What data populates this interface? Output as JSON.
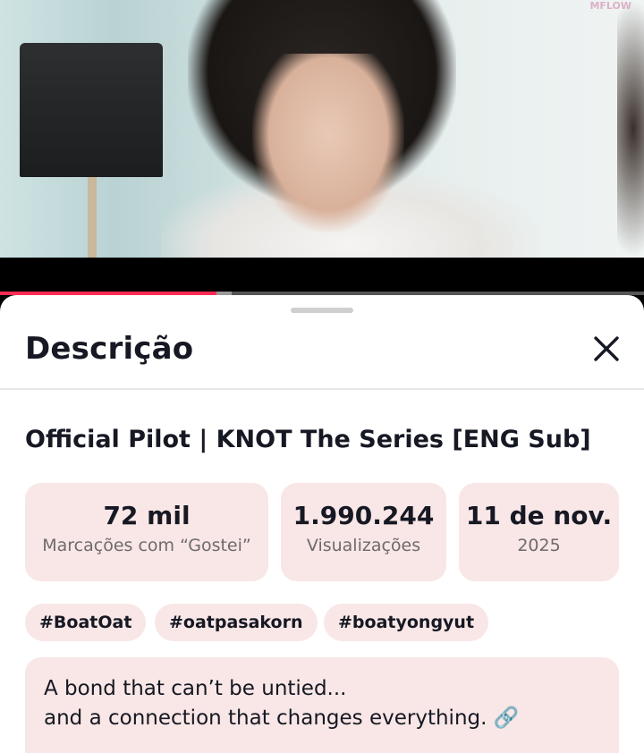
{
  "video": {
    "watermark": "MFLOW",
    "progress_fraction": 0.336,
    "buffer_fraction": 0.36
  },
  "sheet": {
    "title": "Descrição",
    "close_icon": "close-icon"
  },
  "video_title": "Official Pilot | KNOT The Series [ENG Sub]",
  "stats": [
    {
      "value": "72 mil",
      "label": "Marcações com “Gostei”"
    },
    {
      "value": "1.990.244",
      "label": "Visualizações"
    },
    {
      "value": "11 de nov.",
      "label": "2025"
    }
  ],
  "tags": [
    "#BoatOat",
    "#oatpasakorn",
    "#boatyongyut"
  ],
  "description": {
    "line1": "A bond that can’t be untied...",
    "line2": "and a connection that changes everything. 🔗"
  },
  "colors": {
    "accent": "#fe2c55",
    "chip_bg": "#f8e7e6",
    "text": "#161823"
  }
}
